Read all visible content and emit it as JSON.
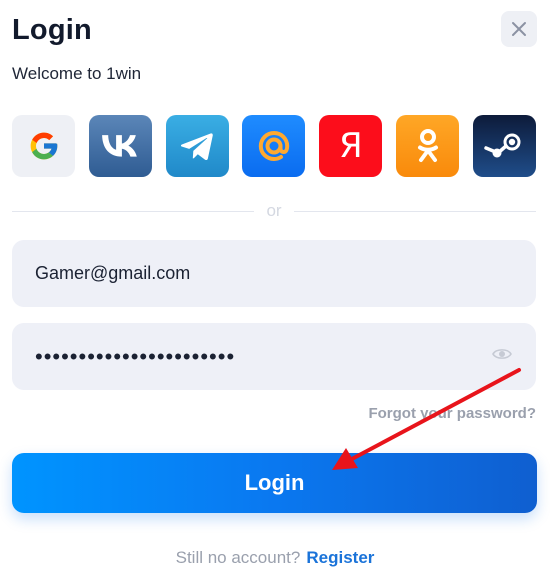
{
  "header": {
    "title": "Login",
    "subtitle": "Welcome to 1win"
  },
  "social": {
    "providers": [
      "google",
      "vk",
      "telegram",
      "mail",
      "yandex",
      "odnoklassniki",
      "steam"
    ],
    "yandex_letter": "Я"
  },
  "divider": {
    "label": "or"
  },
  "form": {
    "email_value": "Gamer@gmail.com",
    "password_value": "•••••••••••••••••••••••",
    "forgot_label": "Forgot your password?",
    "login_label": "Login"
  },
  "footer": {
    "prompt": "Still no account?",
    "register_label": "Register"
  },
  "colors": {
    "accent": "#0a78f0",
    "annotation_arrow": "#e8141b"
  }
}
